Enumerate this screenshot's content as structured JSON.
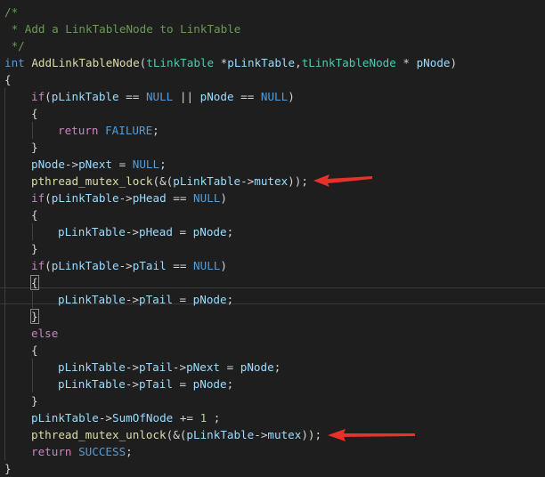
{
  "colors": {
    "background": "#1e1e1e",
    "comment": "#6a9955",
    "keyword": "#569cd6",
    "control": "#c586c0",
    "function": "#dcdcaa",
    "type": "#4ec9b0",
    "variable": "#9cdcfe",
    "number": "#b5cea8",
    "plain": "#d4d4d4",
    "constant": "#569cd6",
    "arrow": "#e8312b"
  },
  "lines": [
    {
      "indent": 0,
      "tokens": [
        {
          "t": "/*",
          "c": "comment"
        }
      ]
    },
    {
      "indent": 0,
      "tokens": [
        {
          "t": " * Add a LinkTableNode to LinkTable",
          "c": "comment"
        }
      ]
    },
    {
      "indent": 0,
      "tokens": [
        {
          "t": " */",
          "c": "comment"
        }
      ]
    },
    {
      "indent": 0,
      "tokens": [
        {
          "t": "int",
          "c": "keyword"
        },
        {
          "t": " ",
          "c": "plain"
        },
        {
          "t": "AddLinkTableNode",
          "c": "function"
        },
        {
          "t": "(",
          "c": "plain"
        },
        {
          "t": "tLinkTable",
          "c": "type"
        },
        {
          "t": " *",
          "c": "plain"
        },
        {
          "t": "pLinkTable",
          "c": "variable"
        },
        {
          "t": ",",
          "c": "plain"
        },
        {
          "t": "tLinkTableNode",
          "c": "type"
        },
        {
          "t": " * ",
          "c": "plain"
        },
        {
          "t": "pNode",
          "c": "variable"
        },
        {
          "t": ")",
          "c": "plain"
        }
      ]
    },
    {
      "indent": 0,
      "tokens": [
        {
          "t": "{",
          "c": "plain"
        }
      ]
    },
    {
      "indent": 1,
      "tokens": [
        {
          "t": "if",
          "c": "control"
        },
        {
          "t": "(",
          "c": "plain"
        },
        {
          "t": "pLinkTable",
          "c": "variable"
        },
        {
          "t": " == ",
          "c": "plain"
        },
        {
          "t": "NULL",
          "c": "constant"
        },
        {
          "t": " || ",
          "c": "plain"
        },
        {
          "t": "pNode",
          "c": "variable"
        },
        {
          "t": " == ",
          "c": "plain"
        },
        {
          "t": "NULL",
          "c": "constant"
        },
        {
          "t": ")",
          "c": "plain"
        }
      ]
    },
    {
      "indent": 1,
      "tokens": [
        {
          "t": "{",
          "c": "plain"
        }
      ]
    },
    {
      "indent": 2,
      "tokens": [
        {
          "t": "return",
          "c": "control"
        },
        {
          "t": " ",
          "c": "plain"
        },
        {
          "t": "FAILURE",
          "c": "constant"
        },
        {
          "t": ";",
          "c": "plain"
        }
      ]
    },
    {
      "indent": 1,
      "tokens": [
        {
          "t": "}",
          "c": "plain"
        }
      ]
    },
    {
      "indent": 1,
      "tokens": [
        {
          "t": "pNode",
          "c": "variable"
        },
        {
          "t": "->",
          "c": "plain"
        },
        {
          "t": "pNext",
          "c": "variable"
        },
        {
          "t": " = ",
          "c": "plain"
        },
        {
          "t": "NULL",
          "c": "constant"
        },
        {
          "t": ";",
          "c": "plain"
        }
      ]
    },
    {
      "indent": 1,
      "tokens": [
        {
          "t": "pthread_mutex_lock",
          "c": "function"
        },
        {
          "t": "(&(",
          "c": "plain"
        },
        {
          "t": "pLinkTable",
          "c": "variable"
        },
        {
          "t": "->",
          "c": "plain"
        },
        {
          "t": "mutex",
          "c": "variable"
        },
        {
          "t": "));",
          "c": "plain"
        }
      ]
    },
    {
      "indent": 1,
      "tokens": [
        {
          "t": "if",
          "c": "control"
        },
        {
          "t": "(",
          "c": "plain"
        },
        {
          "t": "pLinkTable",
          "c": "variable"
        },
        {
          "t": "->",
          "c": "plain"
        },
        {
          "t": "pHead",
          "c": "variable"
        },
        {
          "t": " == ",
          "c": "plain"
        },
        {
          "t": "NULL",
          "c": "constant"
        },
        {
          "t": ")",
          "c": "plain"
        }
      ]
    },
    {
      "indent": 1,
      "tokens": [
        {
          "t": "{",
          "c": "plain"
        }
      ]
    },
    {
      "indent": 2,
      "tokens": [
        {
          "t": "pLinkTable",
          "c": "variable"
        },
        {
          "t": "->",
          "c": "plain"
        },
        {
          "t": "pHead",
          "c": "variable"
        },
        {
          "t": " = ",
          "c": "plain"
        },
        {
          "t": "pNode",
          "c": "variable"
        },
        {
          "t": ";",
          "c": "plain"
        }
      ]
    },
    {
      "indent": 1,
      "tokens": [
        {
          "t": "}",
          "c": "plain"
        }
      ]
    },
    {
      "indent": 1,
      "tokens": [
        {
          "t": "if",
          "c": "control"
        },
        {
          "t": "(",
          "c": "plain"
        },
        {
          "t": "pLinkTable",
          "c": "variable"
        },
        {
          "t": "->",
          "c": "plain"
        },
        {
          "t": "pTail",
          "c": "variable"
        },
        {
          "t": " == ",
          "c": "plain"
        },
        {
          "t": "NULL",
          "c": "constant"
        },
        {
          "t": ")",
          "c": "plain"
        }
      ]
    },
    {
      "indent": 1,
      "tokens": [
        {
          "t": "{",
          "c": "plain",
          "m": true
        }
      ]
    },
    {
      "indent": 2,
      "tokens": [
        {
          "t": "pLinkTable",
          "c": "variable"
        },
        {
          "t": "->",
          "c": "plain"
        },
        {
          "t": "pTail",
          "c": "variable"
        },
        {
          "t": " = ",
          "c": "plain"
        },
        {
          "t": "pNode",
          "c": "variable"
        },
        {
          "t": ";",
          "c": "plain"
        }
      ]
    },
    {
      "indent": 1,
      "tokens": [
        {
          "t": "}",
          "c": "plain",
          "m": true
        }
      ]
    },
    {
      "indent": 1,
      "tokens": [
        {
          "t": "else",
          "c": "control"
        }
      ]
    },
    {
      "indent": 1,
      "tokens": [
        {
          "t": "{",
          "c": "plain"
        }
      ]
    },
    {
      "indent": 2,
      "tokens": [
        {
          "t": "pLinkTable",
          "c": "variable"
        },
        {
          "t": "->",
          "c": "plain"
        },
        {
          "t": "pTail",
          "c": "variable"
        },
        {
          "t": "->",
          "c": "plain"
        },
        {
          "t": "pNext",
          "c": "variable"
        },
        {
          "t": " = ",
          "c": "plain"
        },
        {
          "t": "pNode",
          "c": "variable"
        },
        {
          "t": ";",
          "c": "plain"
        }
      ]
    },
    {
      "indent": 2,
      "tokens": [
        {
          "t": "pLinkTable",
          "c": "variable"
        },
        {
          "t": "->",
          "c": "plain"
        },
        {
          "t": "pTail",
          "c": "variable"
        },
        {
          "t": " = ",
          "c": "plain"
        },
        {
          "t": "pNode",
          "c": "variable"
        },
        {
          "t": ";",
          "c": "plain"
        }
      ]
    },
    {
      "indent": 1,
      "tokens": [
        {
          "t": "}",
          "c": "plain"
        }
      ]
    },
    {
      "indent": 1,
      "tokens": [
        {
          "t": "pLinkTable",
          "c": "variable"
        },
        {
          "t": "->",
          "c": "plain"
        },
        {
          "t": "SumOfNode",
          "c": "variable"
        },
        {
          "t": " += ",
          "c": "plain"
        },
        {
          "t": "1",
          "c": "number"
        },
        {
          "t": " ;",
          "c": "plain"
        }
      ]
    },
    {
      "indent": 1,
      "tokens": [
        {
          "t": "pthread_mutex_unlock",
          "c": "function"
        },
        {
          "t": "(&(",
          "c": "plain"
        },
        {
          "t": "pLinkTable",
          "c": "variable"
        },
        {
          "t": "->",
          "c": "plain"
        },
        {
          "t": "mutex",
          "c": "variable"
        },
        {
          "t": "));",
          "c": "plain"
        }
      ]
    },
    {
      "indent": 1,
      "tokens": [
        {
          "t": "return",
          "c": "control"
        },
        {
          "t": " ",
          "c": "plain"
        },
        {
          "t": "SUCCESS",
          "c": "constant"
        },
        {
          "t": ";",
          "c": "plain"
        }
      ]
    },
    {
      "indent": 0,
      "tokens": [
        {
          "t": "}",
          "c": "plain"
        }
      ]
    }
  ],
  "annotations": [
    {
      "target_line": 10,
      "icon": "red-arrow-icon"
    },
    {
      "target_line": 25,
      "icon": "red-arrow-icon"
    }
  ]
}
